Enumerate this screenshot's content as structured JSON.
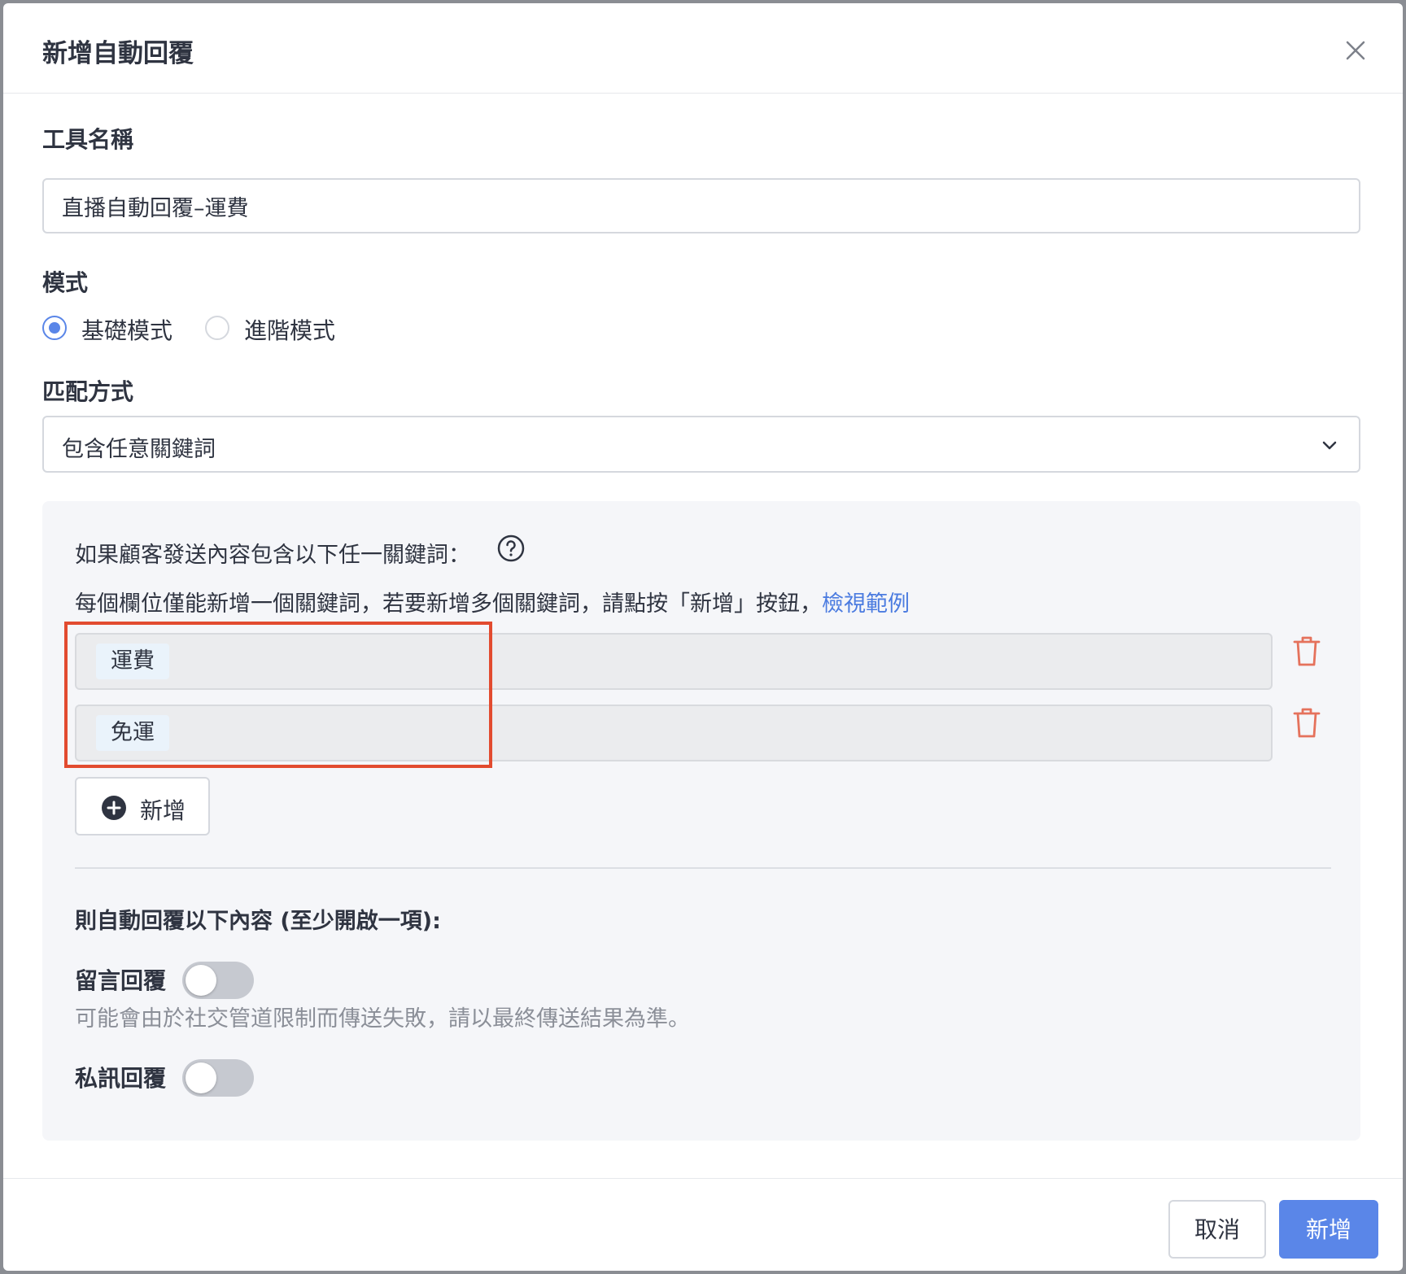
{
  "dialog": {
    "title": "新增自動回覆"
  },
  "form": {
    "tool_name": {
      "label": "工具名稱",
      "value": "直播自動回覆–運費"
    },
    "mode": {
      "label": "模式",
      "options": [
        {
          "label": "基礎模式",
          "selected": true
        },
        {
          "label": "進階模式",
          "selected": false
        }
      ]
    },
    "match": {
      "label": "匹配方式",
      "value": "包含任意關鍵詞"
    }
  },
  "condition": {
    "text": "如果顧客發送內容包含以下任一關鍵詞：",
    "hint": "每個欄位僅能新增一個關鍵詞，若要新增多個關鍵詞，請點按「新增」按鈕，",
    "hint_link": "檢視範例",
    "keywords": [
      "運費",
      "免運"
    ],
    "add_label": "新增"
  },
  "reply": {
    "heading": "則自動回覆以下內容 (至少開啟一項):",
    "comment_reply": {
      "label": "留言回覆",
      "enabled": false
    },
    "note": "可能會由於社交管道限制而傳送失敗，請以最終傳送結果為準。",
    "private_reply": {
      "label": "私訊回覆",
      "enabled": false
    }
  },
  "footer": {
    "cancel_label": "取消",
    "submit_label": "新增"
  },
  "colors": {
    "accent": "#5a86e8",
    "link": "#4c7ce0",
    "danger": "#e5725c",
    "highlight_border": "#e24b2f"
  },
  "icons": [
    "close-icon",
    "help-circle-icon",
    "chevron-down-icon",
    "trash-icon",
    "plus-circle-icon"
  ]
}
